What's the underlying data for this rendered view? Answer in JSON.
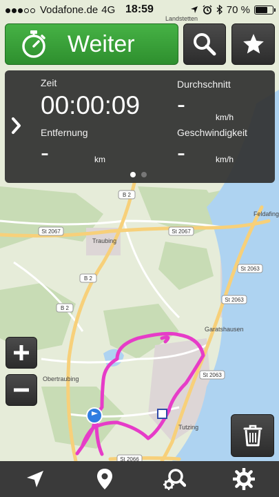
{
  "status_bar": {
    "carrier": "Vodafone.de",
    "network": "4G",
    "time": "18:59",
    "battery_percent": "70 %",
    "battery_level": 0.7
  },
  "header": {
    "weiter_label": "Weiter"
  },
  "stats": {
    "zeit_label": "Zeit",
    "zeit_value": "00:00:09",
    "durchschnitt_label": "Durchschnitt",
    "durchschnitt_value": "-",
    "durchschnitt_unit": "km/h",
    "entfernung_label": "Entfernung",
    "entfernung_value": "-",
    "entfernung_unit": "km",
    "geschwindigkeit_label": "Geschwindigkeit",
    "geschwindigkeit_value": "-",
    "geschwindigkeit_unit": "km/h",
    "page": 1,
    "pages": 2
  },
  "map": {
    "places": {
      "landstetten": "Landstetten",
      "traubing": "Traubing",
      "feldafing": "Feldafing",
      "garatshausen": "Garatshausen",
      "obertraubing": "Obertraubing",
      "tutzing": "Tutzing"
    },
    "roads": {
      "st2067a": "St 2067",
      "st2067b": "St 2067",
      "st2063a": "St 2063",
      "st2063b": "St 2063",
      "st2063c": "St 2063",
      "st2066": "St 2066",
      "b2a": "B 2",
      "b2b": "B 2",
      "b2c": "B 2"
    },
    "colors": {
      "land": "#e6ecd9",
      "forest": "#c8dcb5",
      "water": "#aed3f1",
      "road_major": "#f7d07a",
      "road_minor": "#ffffff",
      "track": "#e63cc8",
      "position": "#2f7de1"
    }
  },
  "colors": {
    "weiter_green": "#3a9f3a",
    "panel_bg": "#303030",
    "toolbar_bg": "#3a3a3a"
  },
  "icons": {
    "weiter": "stopwatch-icon",
    "search": "search-icon",
    "favorite": "star-icon",
    "expand": "chevron-right-icon",
    "zoom_in": "plus-icon",
    "zoom_out": "minus-icon",
    "trash": "trash-icon",
    "navigate": "navigation-arrow-icon",
    "location": "map-pin-icon",
    "search_settings": "search-settings-icon",
    "settings": "gear-icon"
  }
}
